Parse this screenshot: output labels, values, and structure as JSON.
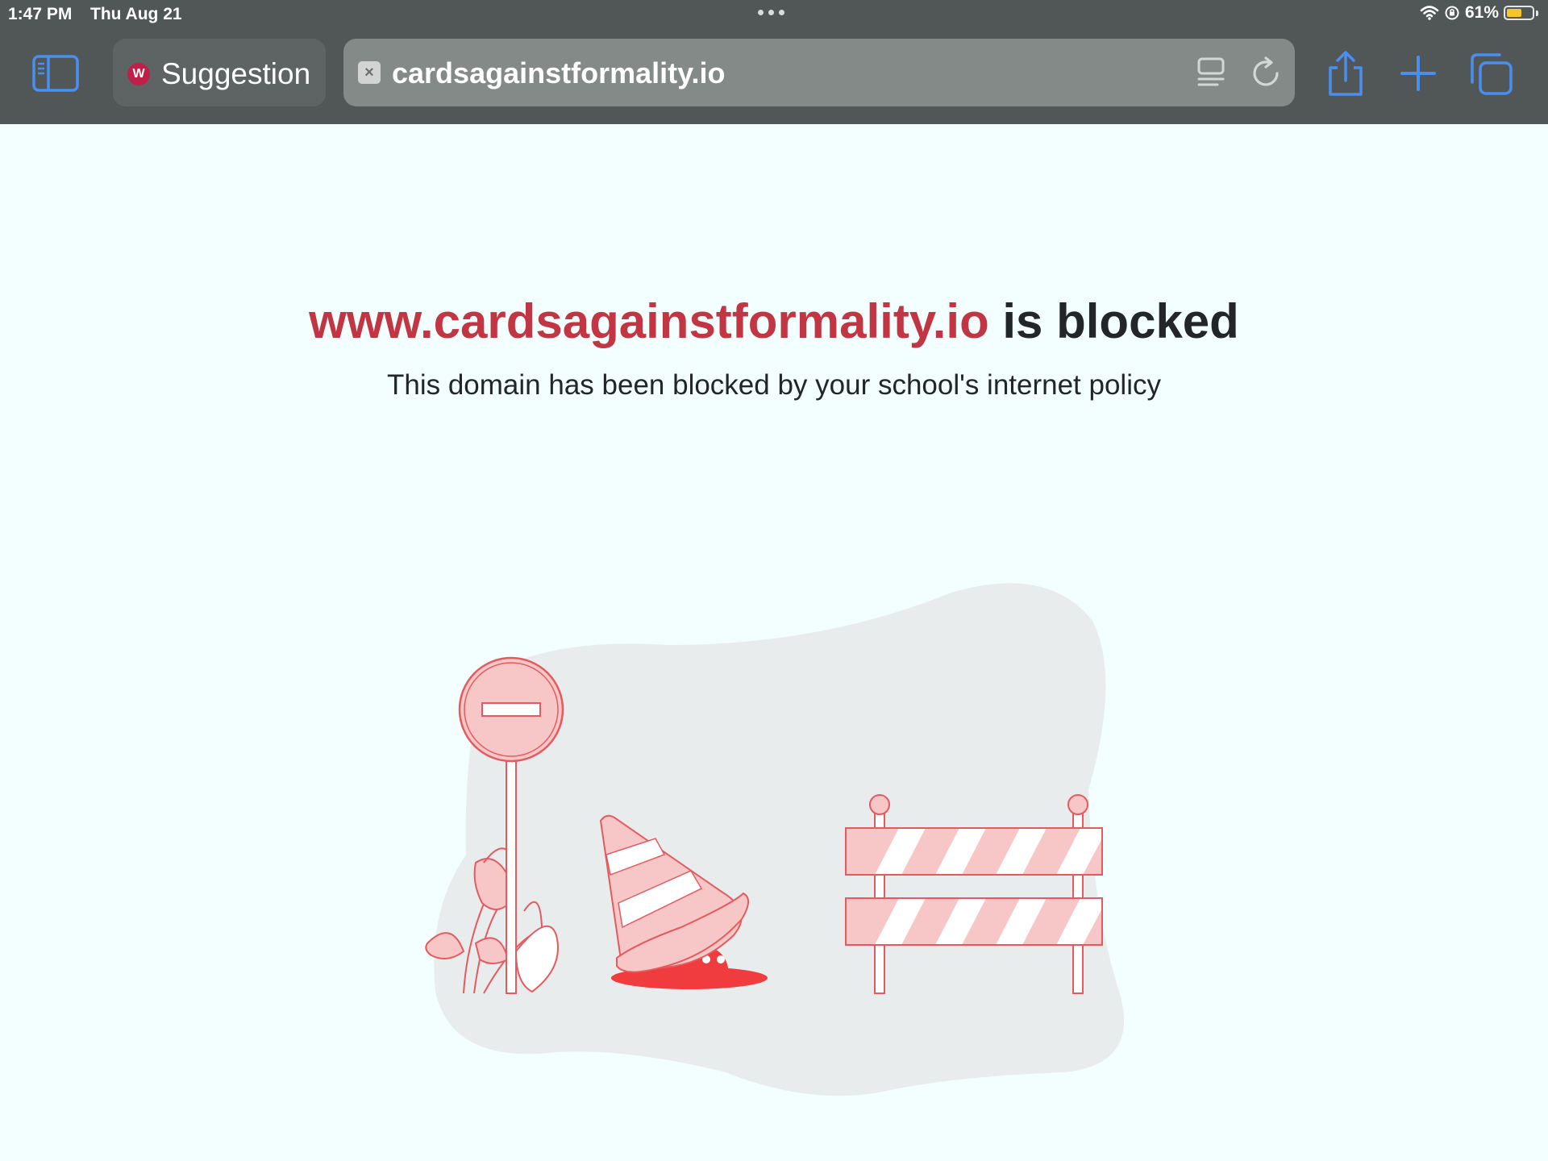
{
  "status_bar": {
    "time": "1:47 PM",
    "date": "Thu Aug 21",
    "battery_percent": "61%",
    "battery_level": 0.61
  },
  "toolbar": {
    "tab": {
      "favicon_letter": "W",
      "label": "Suggestion"
    },
    "url_bar": {
      "url": "cardsagainstformality.io",
      "favicon_glyph": "×"
    },
    "icons": [
      "sidebar-icon",
      "reader-icon",
      "reload-icon",
      "share-icon",
      "plus-icon",
      "tabs-icon"
    ]
  },
  "page": {
    "domain": "www.cardsagainstformality.io",
    "blocked_suffix": "is blocked",
    "message": "This domain has been blocked by your school's internet policy"
  },
  "colors": {
    "chrome": "#515756",
    "page_background": "#f2fffe",
    "accent_red": "#c23643",
    "icon_blue": "#4a8ef0",
    "illustration_pink": "#f7c7c8",
    "illustration_stroke": "#e55a5f",
    "blob_gray": "#e8ecec"
  }
}
